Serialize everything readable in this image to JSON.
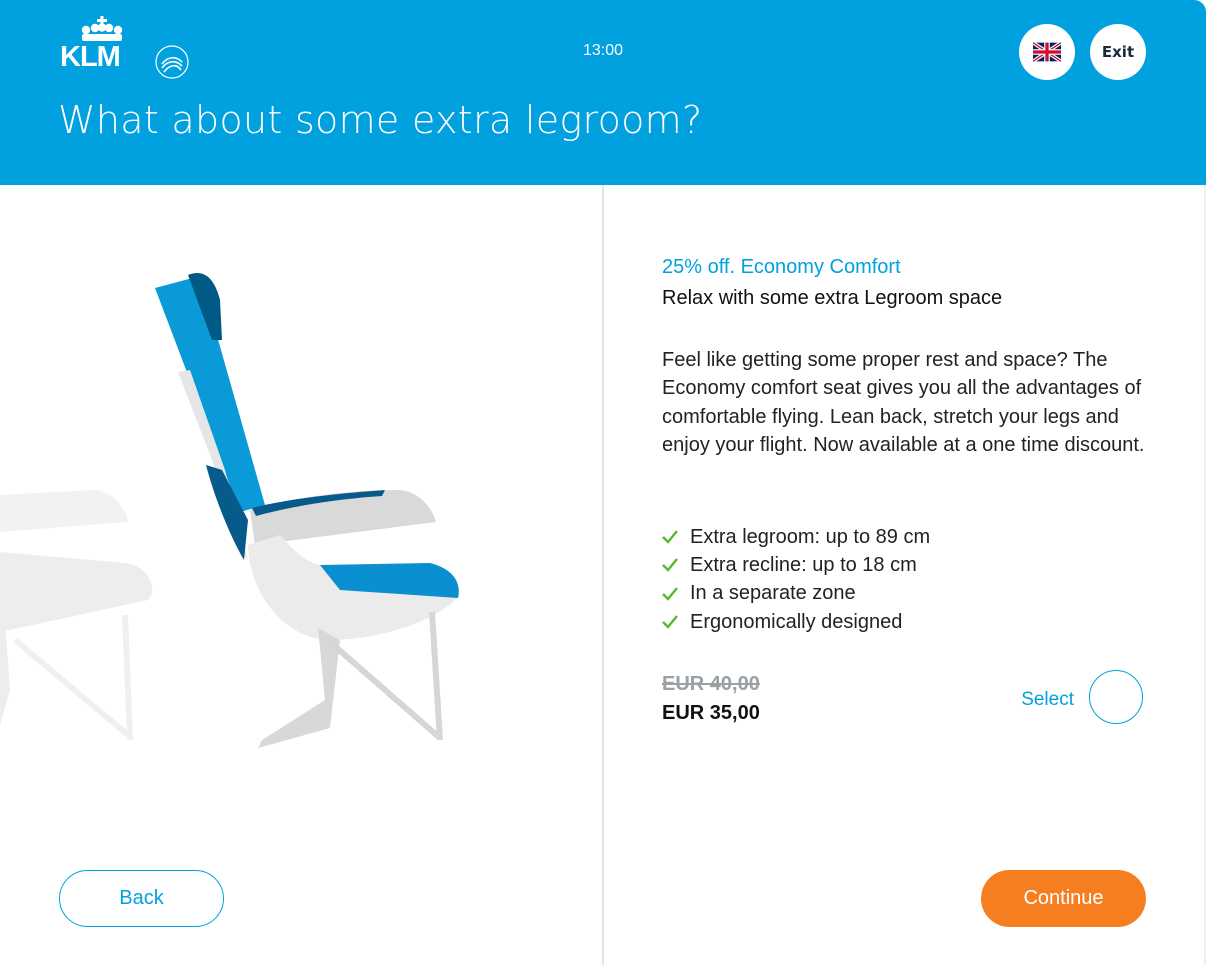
{
  "header": {
    "logo": {
      "brand": "KLM",
      "alliance": "SKYTEAM",
      "icon": "klm-crown-logo"
    },
    "time": "13:00",
    "language": {
      "icon": "uk-flag-icon",
      "code": "EN"
    },
    "exit_label": "Exit",
    "title": "What about some extra legroom?",
    "background_color": "#00a1de"
  },
  "illustration": {
    "icon": "airline-seat-illustration"
  },
  "offer": {
    "title": "25% off. Economy Comfort",
    "subtitle": "Relax with some extra Legroom space",
    "description": "Feel like getting some proper rest and space? The Economy comfort seat gives you all the advantages of comfortable flying. Lean back, stretch your legs and enjoy your flight. Now available at a one time discount.",
    "features": [
      "Extra legroom: up to 89 cm",
      "Extra recline: up to 18 cm",
      "In a separate zone",
      "Ergonomically designed"
    ],
    "old_price": "EUR 40,00",
    "new_price": "EUR 35,00",
    "select_label": "Select",
    "selected": false,
    "accent_color": "#00a1de",
    "check_color": "#58b82a"
  },
  "footer": {
    "back_label": "Back",
    "continue_label": "Continue",
    "continue_color": "#f47e20"
  }
}
